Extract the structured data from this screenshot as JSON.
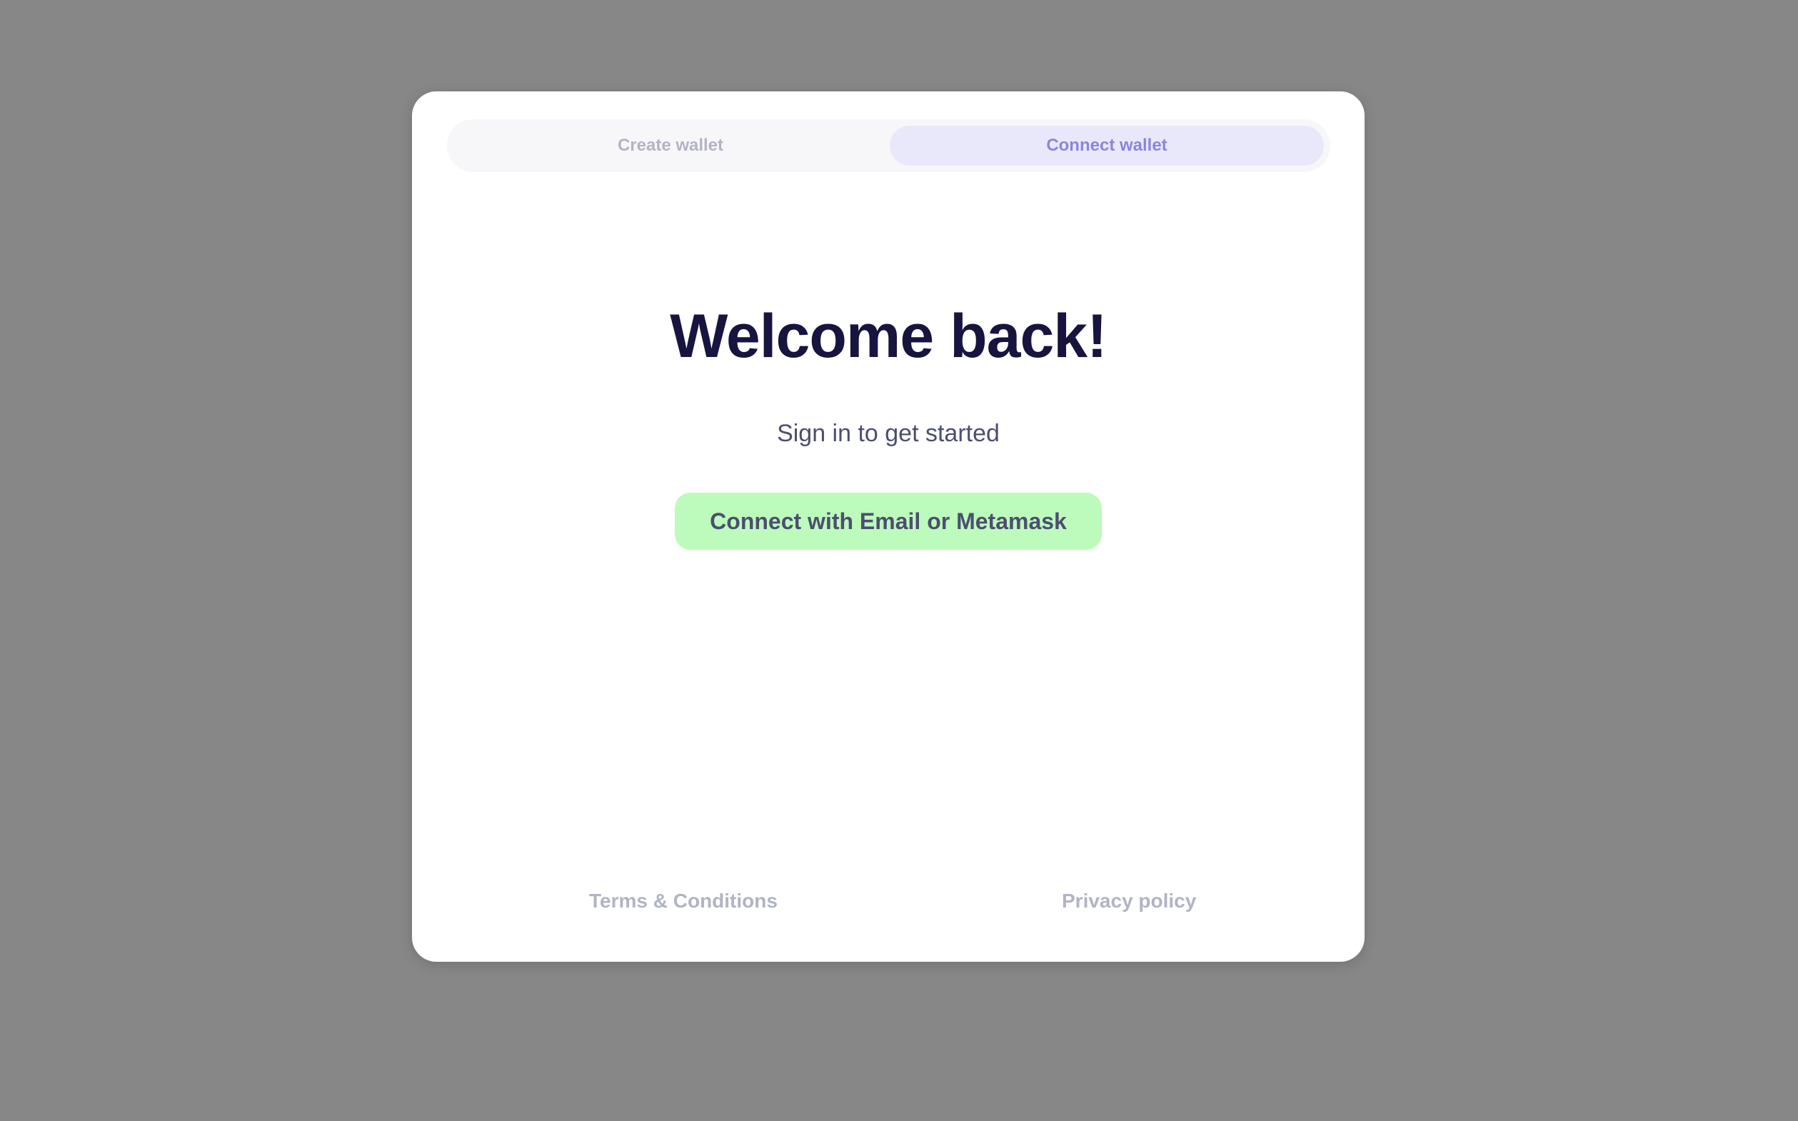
{
  "tabs": {
    "create_label": "Create wallet",
    "connect_label": "Connect wallet",
    "active": "Connect wallet"
  },
  "main": {
    "title": "Welcome back!",
    "subtitle": "Sign in to get started",
    "connect_button_label": "Connect with Email or Metamask"
  },
  "footer": {
    "terms_label": "Terms & Conditions",
    "privacy_label": "Privacy policy"
  },
  "colors": {
    "overlay": "#878787",
    "title": "#17153f",
    "accent_tab": "#8b86d9",
    "accent_tab_bg": "#e9e8fb",
    "button_bg": "#bcfbbc",
    "muted_text": "#b1b3c6"
  }
}
